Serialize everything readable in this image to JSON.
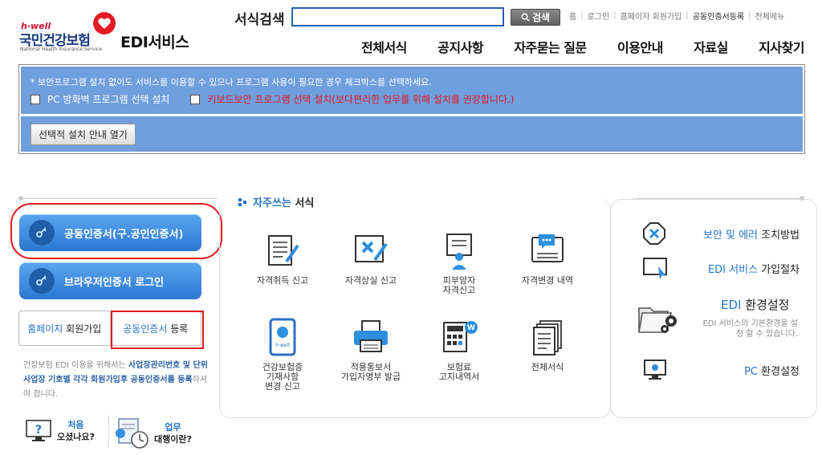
{
  "brand": {
    "hwell": "h·well",
    "org": "국민건강보험",
    "org_en": "National Health Insurance Service",
    "service": "EDI서비스"
  },
  "search": {
    "label": "서식검색",
    "value": "",
    "button": "검색"
  },
  "util_nav": [
    "홈",
    "로그인",
    "홈페이지 회원가입",
    "공동인증서등록",
    "전체메뉴"
  ],
  "main_nav": [
    "전체서식",
    "공지사항",
    "자주묻는 질문",
    "이용안내",
    "자료실",
    "지사찾기"
  ],
  "notice": {
    "message": "* 보안프로그램 설치 없이도 서비스를 이용할 수 있으나 프로그램 사용이 필요한 경우 체크박스를 선택하세요.",
    "option1": "PC 방화벽 프로그램 선택 설치",
    "option2": "키보드보안 프로그램 선택 설치(보다편리한 업무를 위해 설치를 권장합니다.)",
    "install_button": "선택적 설치 안내 열기"
  },
  "login": {
    "cert_button": "공동인증서(구.공인인증서)",
    "browser_button": "브라우저인증서 로그인",
    "homepage_blue": "홈페이지",
    "homepage_dark": "회원가입",
    "register_blue": "공동인증서",
    "register_dark": "등록",
    "desc_1": "건강보험 EDI 이용을 위해서는 ",
    "desc_2": "사업장관리번호 및 단위 사업장 기호별 각각 회원가입후 공동인증서를 등록",
    "desc_3": "하셔야 합니다."
  },
  "help": {
    "first_t1": "처음",
    "first_t2": "오셨나요?",
    "proxy_t1": "업무",
    "proxy_t2": "대행이란?"
  },
  "favorites": {
    "title_blue": "자주쓰는",
    "title_dark": "서식",
    "items": [
      {
        "label": "자격취득 신고",
        "icon": "document-pen-icon"
      },
      {
        "label": "자격상실 신고",
        "icon": "document-x-icon"
      },
      {
        "label": "피부양자\n자격신고",
        "icon": "dependent-person-icon"
      },
      {
        "label": "자격변경 내역",
        "icon": "monitor-chat-icon"
      },
      {
        "label": "건강보험증\n기재사항\n변경 신고",
        "icon": "insurance-card-icon"
      },
      {
        "label": "적용통보서\n가입자명부 발급",
        "icon": "printer-icon"
      },
      {
        "label": "보험료\n고지내역서",
        "icon": "calculator-icon"
      },
      {
        "label": "전체서식",
        "icon": "document-stack-icon"
      }
    ]
  },
  "right": {
    "security_blue": "보안 및 에러",
    "security_dark": "조치방법",
    "join_blue": "EDI 서비스",
    "join_dark": "가입절차",
    "env_blue": "EDI",
    "env_dark": "환경설정",
    "env_desc": "EDI 서비스의 기본환경을 설정 할 수 있습니다.",
    "pc_blue": "PC",
    "pc_dark": "환경설정"
  }
}
